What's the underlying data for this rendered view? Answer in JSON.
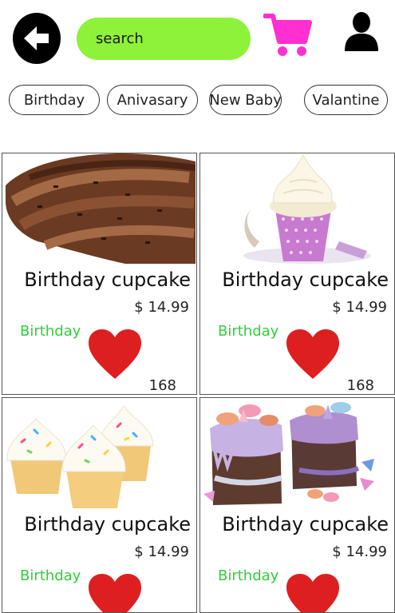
{
  "header": {
    "search": {
      "placeholder": "search",
      "value": ""
    },
    "back_icon": "arrow-left-icon",
    "cart_icon": "shopping-cart-icon",
    "user_icon": "user-icon",
    "colors": {
      "search_bg": "#8ef13a",
      "cart": "#ff2fd1",
      "heart": "#dd1f1f",
      "category": "#2fd03a"
    }
  },
  "categories": [
    {
      "label": "Birthday"
    },
    {
      "label": "Anivasary"
    },
    {
      "label": "New Baby"
    },
    {
      "label": "Valantine"
    }
  ],
  "products": [
    {
      "title": "Birthday cupcake",
      "price": "$ 14.99",
      "category": "Birthday",
      "likes": "168",
      "image": "chocolate-frosting-cupcake"
    },
    {
      "title": "Birthday cupcake",
      "price": "$ 14.99",
      "category": "Birthday",
      "likes": "168",
      "image": "pink-polka-dot-cupcake"
    },
    {
      "title": "Birthday cupcake",
      "price": "$ 14.99",
      "category": "Birthday",
      "likes": "",
      "image": "sprinkle-vanilla-cupcakes"
    },
    {
      "title": "Birthday cupcake",
      "price": "$ 14.99",
      "category": "Birthday",
      "likes": "",
      "image": "decorated-macaron-cakes"
    }
  ]
}
